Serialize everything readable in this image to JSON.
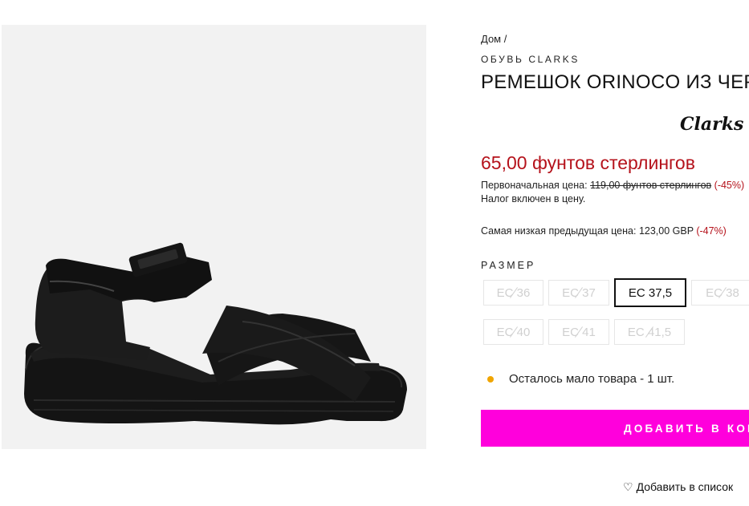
{
  "breadcrumb": "Дом /",
  "brand": "ОБУВЬ CLARKS",
  "title": "РЕМЕШОК ORINOCO ИЗ ЧЕРНОЙ КОЖИ",
  "logo_text": "Clarks",
  "price": {
    "current": "65,00 фунтов стерлингов",
    "original_label": "Первоначальная цена:",
    "original_value": "119,00 фунтов стерлингов",
    "original_discount": "(-45%)",
    "tax_note": "Налог включен в цену.",
    "lowest_label": "Самая низкая предыдущая цена:",
    "lowest_value": "123,00 GBP",
    "lowest_discount": "(-47%)"
  },
  "size": {
    "label": "РАЗМЕР",
    "options": [
      {
        "label": "EC 36",
        "available": false
      },
      {
        "label": "EC 37",
        "available": false
      },
      {
        "label": "EC 37,5",
        "available": true,
        "selected": true
      },
      {
        "label": "EC 38",
        "available": false
      },
      {
        "label": "EC 40",
        "available": false
      },
      {
        "label": "EC 41",
        "available": false
      },
      {
        "label": "EC 41,5",
        "available": false
      }
    ]
  },
  "stock": {
    "text": "Осталось мало товара - 1 шт.",
    "dot_color": "#f0a500"
  },
  "add_to_cart": {
    "label": "ДОБАВИТЬ В КОРЗИНУ",
    "color": "#ff00dc"
  },
  "wishlist": {
    "label": "Добавить в список",
    "icon": "heart-outline-icon"
  },
  "colors": {
    "sale": "#b5121b"
  }
}
